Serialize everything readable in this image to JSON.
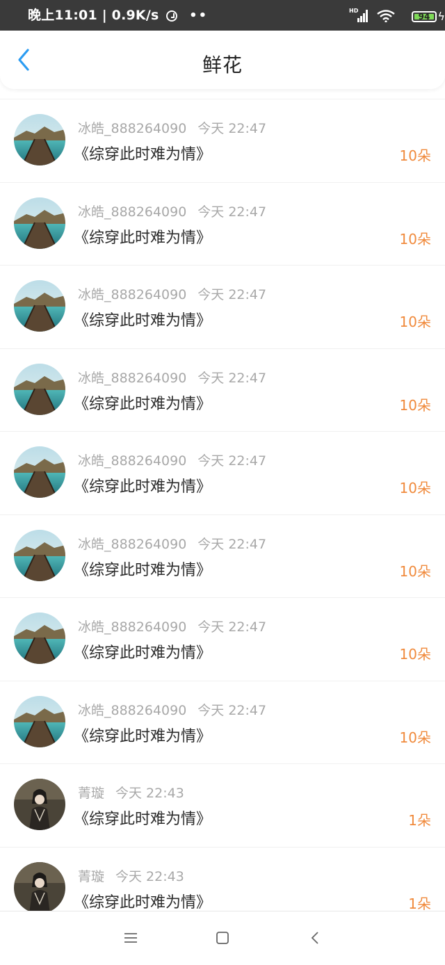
{
  "status_bar": {
    "time_speed": "晚上11:01 | 0.9K/s",
    "dots": "••",
    "network_label": "HD",
    "battery_level": "94"
  },
  "header": {
    "title": "鲜花"
  },
  "items": [
    {
      "user": "冰皓_888264090",
      "time": "今天 22:47",
      "book": "《综穿此时难为情》",
      "count": "10朵",
      "avatar": "bridge"
    },
    {
      "user": "冰皓_888264090",
      "time": "今天 22:47",
      "book": "《综穿此时难为情》",
      "count": "10朵",
      "avatar": "bridge"
    },
    {
      "user": "冰皓_888264090",
      "time": "今天 22:47",
      "book": "《综穿此时难为情》",
      "count": "10朵",
      "avatar": "bridge"
    },
    {
      "user": "冰皓_888264090",
      "time": "今天 22:47",
      "book": "《综穿此时难为情》",
      "count": "10朵",
      "avatar": "bridge"
    },
    {
      "user": "冰皓_888264090",
      "time": "今天 22:47",
      "book": "《综穿此时难为情》",
      "count": "10朵",
      "avatar": "bridge"
    },
    {
      "user": "冰皓_888264090",
      "time": "今天 22:47",
      "book": "《综穿此时难为情》",
      "count": "10朵",
      "avatar": "bridge"
    },
    {
      "user": "冰皓_888264090",
      "time": "今天 22:47",
      "book": "《综穿此时难为情》",
      "count": "10朵",
      "avatar": "bridge"
    },
    {
      "user": "冰皓_888264090",
      "time": "今天 22:47",
      "book": "《综穿此时难为情》",
      "count": "10朵",
      "avatar": "bridge"
    },
    {
      "user": "菁璇",
      "time": "今天 22:43",
      "book": "《综穿此时难为情》",
      "count": "1朵",
      "avatar": "portrait"
    },
    {
      "user": "菁璇",
      "time": "今天 22:43",
      "book": "《综穿此时难为情》",
      "count": "1朵",
      "avatar": "portrait"
    }
  ],
  "colors": {
    "accent": "#2b9cf2",
    "count": "#f08a3c",
    "meta": "#a8a8a8"
  }
}
